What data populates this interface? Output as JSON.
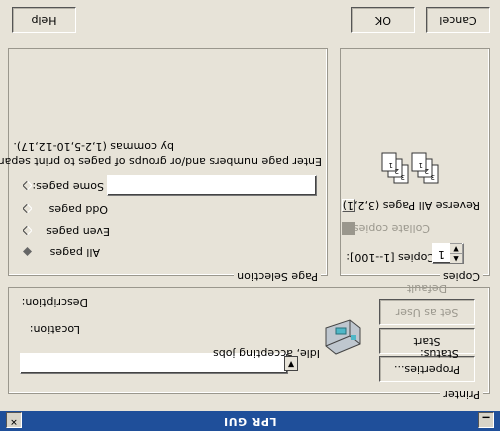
{
  "window": {
    "title": "LPR GUI",
    "minimize_icon": "minimize-icon",
    "close_icon": "close-icon"
  },
  "printer": {
    "group_label": "Printer",
    "selected": "",
    "properties_label": "Properties...",
    "start_label": "Start",
    "set_default_label": "Set as User Default",
    "status_label": "Status:",
    "status_value": "Idle, accepting jobs",
    "location_label": "Location:",
    "location_value": "",
    "description_label": "Description:",
    "description_value": "",
    "icon": "printer-icon"
  },
  "page_selection": {
    "group_label": "Page Selection",
    "options": [
      "All pages",
      "Even pages",
      "Odd pages",
      "Some pages:"
    ],
    "selected": "All pages",
    "some_pages_value": "",
    "hint_line1": "Enter page numbers and/or groups of pages to print separated",
    "hint_line2": "by commas (1,2-5,10-12,17)."
  },
  "copies": {
    "group_label": "Copies",
    "count_label": "Copies [1--100]:",
    "count_value": "1",
    "collate_label": "Collate copies",
    "collate_checked": true,
    "collate_disabled": true,
    "reverse_label": "Reverse All Pages (3,2,1)",
    "reverse_checked": false,
    "collate_icon": "collate-pages-icon"
  },
  "buttons": {
    "help": "Help",
    "ok": "OK",
    "cancel": "Cancel"
  },
  "colors": {
    "titlebar": "#1f4f9a",
    "window_bg": "#e7e3d8"
  }
}
